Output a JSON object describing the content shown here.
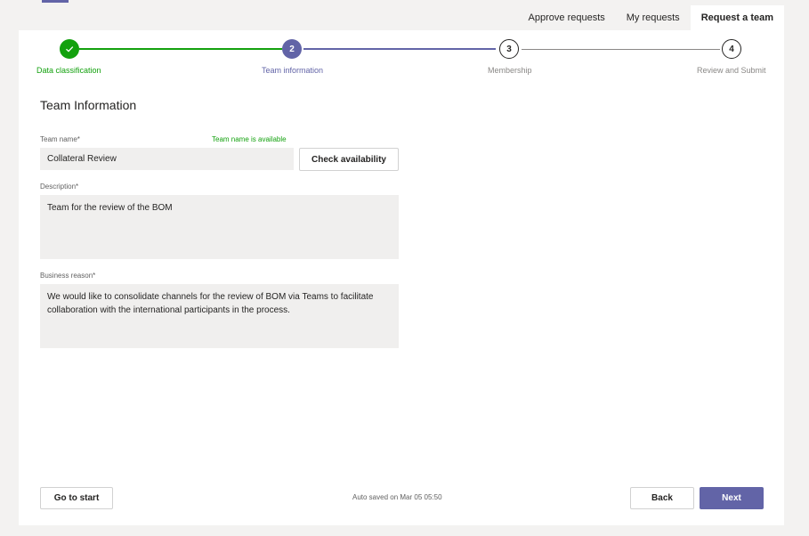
{
  "tabs": [
    {
      "label": "Approve requests"
    },
    {
      "label": "My requests"
    },
    {
      "label": "Request a team"
    }
  ],
  "stepper": {
    "steps": [
      {
        "label": "Data classification",
        "number": "",
        "status": "complete"
      },
      {
        "label": "Team information",
        "number": "2",
        "status": "current"
      },
      {
        "label": "Membership",
        "number": "3",
        "status": "upcoming"
      },
      {
        "label": "Review and Submit",
        "number": "4",
        "status": "upcoming"
      }
    ]
  },
  "form": {
    "section_title": "Team Information",
    "team_name": {
      "label": "Team name*",
      "value": "Collateral Review",
      "availability_message": "Team name is available"
    },
    "check_availability_label": "Check availability",
    "description": {
      "label": "Description*",
      "value": "Team for the review of the BOM"
    },
    "business_reason": {
      "label": "Business reason*",
      "value": "We would like to consolidate channels for the review of BOM via Teams to facilitate collaboration with the international participants in the process."
    }
  },
  "footer": {
    "go_to_start_label": "Go to start",
    "autosave_text": "Auto saved on Mar 05 05:50",
    "back_label": "Back",
    "next_label": "Next"
  },
  "colors": {
    "accent": "#6264a7",
    "success": "#13a10e",
    "neutral_line": "#8a8886"
  }
}
